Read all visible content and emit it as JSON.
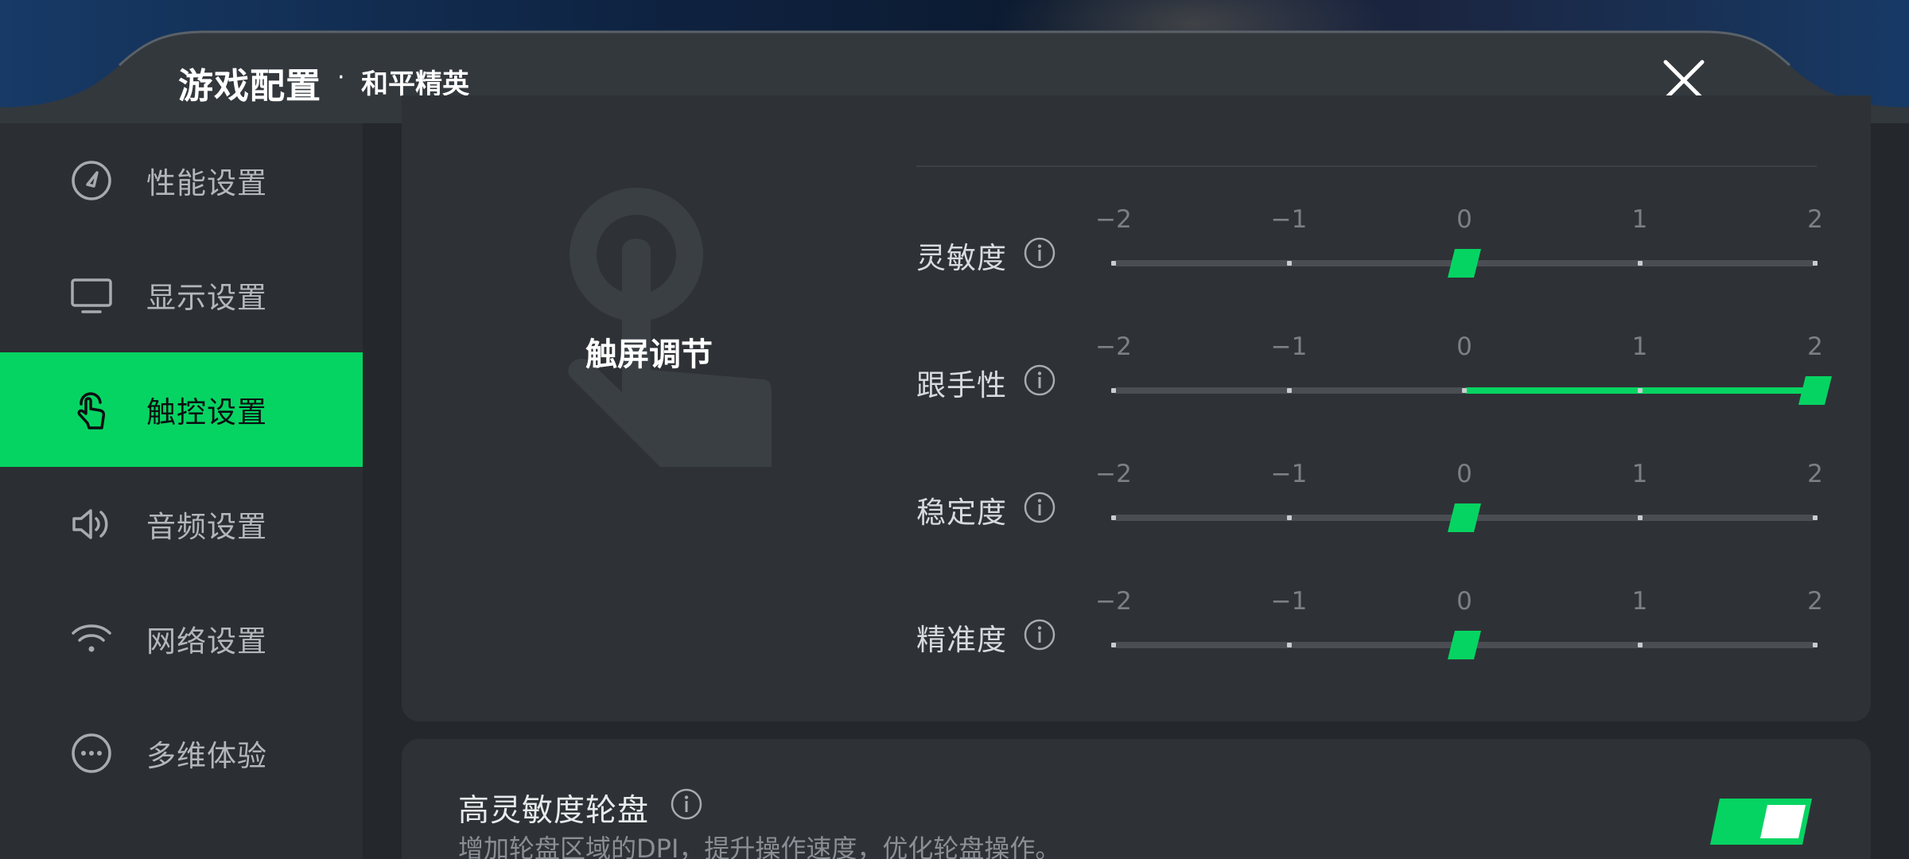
{
  "header": {
    "title": "游戏配置",
    "separator": "·",
    "subtitle": "和平精英",
    "close_icon": "close-icon"
  },
  "sidebar": {
    "items": [
      {
        "label": "性能设置",
        "icon": "gauge-icon",
        "active": false
      },
      {
        "label": "显示设置",
        "icon": "monitor-icon",
        "active": false
      },
      {
        "label": "触控设置",
        "icon": "touch-hand-icon",
        "active": true
      },
      {
        "label": "音频设置",
        "icon": "speaker-icon",
        "active": false
      },
      {
        "label": "网络设置",
        "icon": "wifi-icon",
        "active": false
      },
      {
        "label": "多维体验",
        "icon": "more-dots-icon",
        "active": false
      }
    ]
  },
  "touch_section": {
    "title": "触屏调节",
    "tick_labels": [
      "−2",
      "−1",
      "0",
      "1",
      "2"
    ],
    "sliders": [
      {
        "label": "灵敏度",
        "value": 0
      },
      {
        "label": "跟手性",
        "value": 2
      },
      {
        "label": "稳定度",
        "value": 0
      },
      {
        "label": "精准度",
        "value": 0
      }
    ]
  },
  "wheel_option": {
    "title": "高灵敏度轮盘",
    "description": "增加轮盘区域的DPI，提升操作速度，优化轮盘操作。",
    "enabled": true
  },
  "colors": {
    "accent": "#06d462",
    "panel": "#2e3236",
    "sidebar": "#2b2f33"
  }
}
